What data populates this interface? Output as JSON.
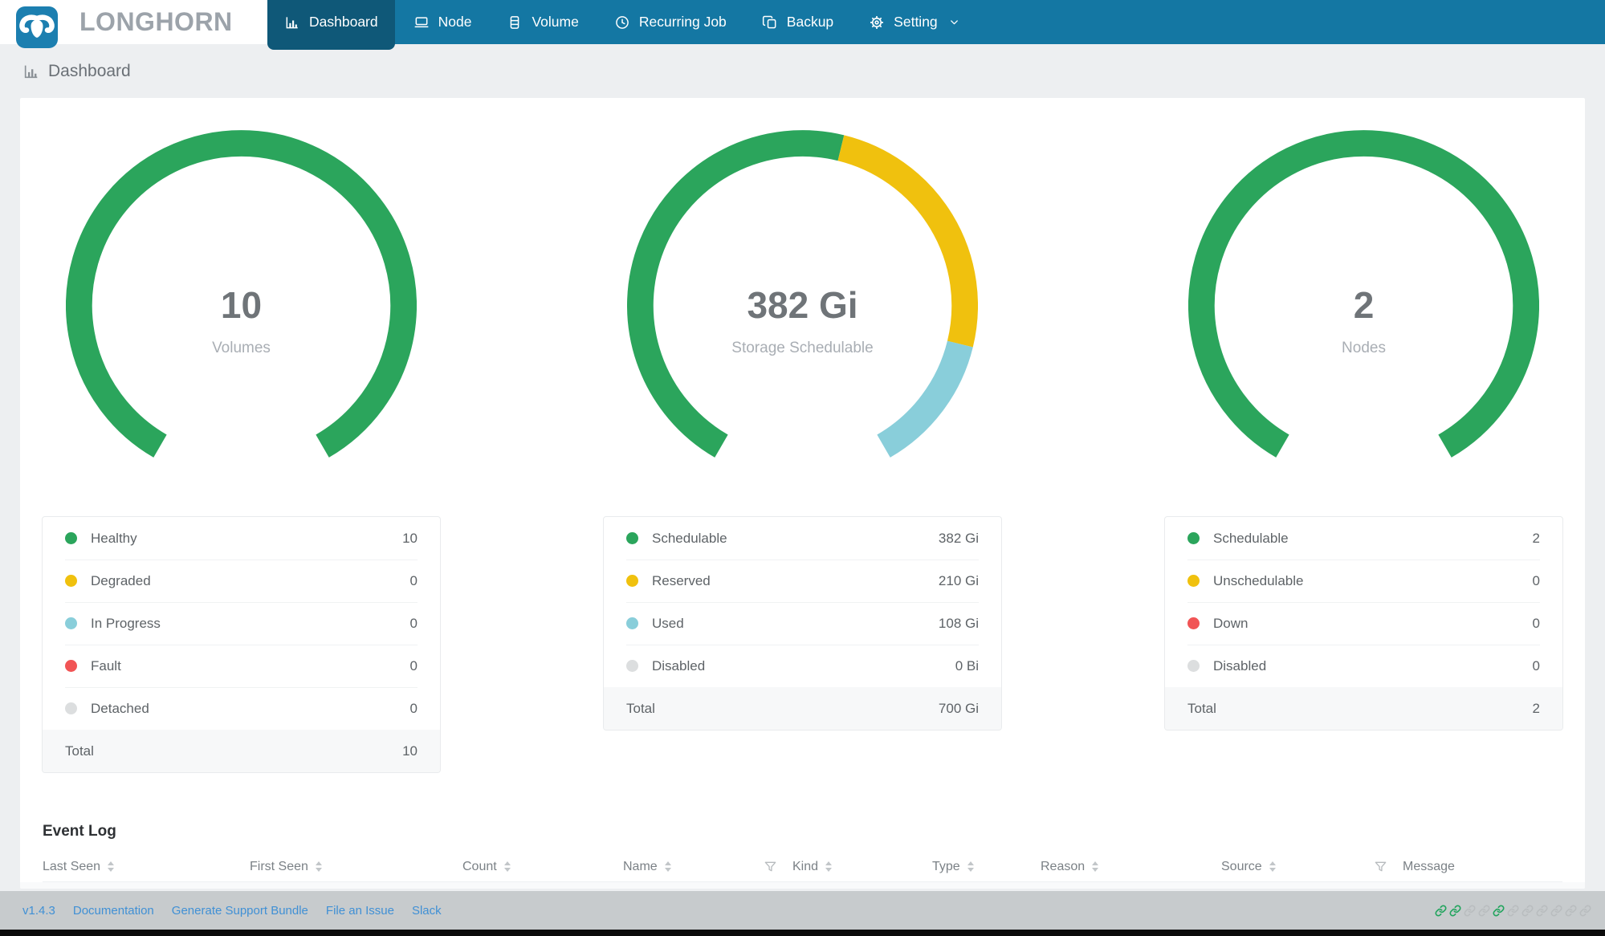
{
  "brand": {
    "name": "LONGHORN",
    "logo_icon": "bull-icon"
  },
  "nav": {
    "items": [
      {
        "label": "Dashboard",
        "icon": "bar-chart-icon",
        "active": true,
        "has_dropdown": false
      },
      {
        "label": "Node",
        "icon": "node-icon",
        "active": false,
        "has_dropdown": false
      },
      {
        "label": "Volume",
        "icon": "volume-icon",
        "active": false,
        "has_dropdown": false
      },
      {
        "label": "Recurring Job",
        "icon": "clock-icon",
        "active": false,
        "has_dropdown": false
      },
      {
        "label": "Backup",
        "icon": "backup-icon",
        "active": false,
        "has_dropdown": false
      },
      {
        "label": "Setting",
        "icon": "gear-icon",
        "active": false,
        "has_dropdown": true
      }
    ]
  },
  "page": {
    "title": "Dashboard",
    "title_icon": "bar-chart-icon"
  },
  "chart_data": [
    {
      "type": "gauge",
      "center_value": "10",
      "center_label": "Volumes",
      "total": 10,
      "arc_span_degrees": 300,
      "segments": [
        {
          "name": "Healthy",
          "value": 10,
          "color": "#2BA55C"
        }
      ],
      "legend": [
        {
          "label": "Healthy",
          "value": "10",
          "color": "#2BA55C"
        },
        {
          "label": "Degraded",
          "value": "0",
          "color": "#F0C10E"
        },
        {
          "label": "In Progress",
          "value": "0",
          "color": "#89CEDA"
        },
        {
          "label": "Fault",
          "value": "0",
          "color": "#F15455"
        },
        {
          "label": "Detached",
          "value": "0",
          "color": "#DCDEDF"
        }
      ],
      "total_row": {
        "label": "Total",
        "value": "10"
      }
    },
    {
      "type": "gauge",
      "center_value": "382 Gi",
      "center_label": "Storage Schedulable",
      "total": 700,
      "arc_span_degrees": 300,
      "segments": [
        {
          "name": "Schedulable",
          "value": 382,
          "color": "#2BA55C"
        },
        {
          "name": "Reserved",
          "value": 210,
          "color": "#F0C10E"
        },
        {
          "name": "Used",
          "value": 108,
          "color": "#89CEDA"
        }
      ],
      "legend": [
        {
          "label": "Schedulable",
          "value": "382 Gi",
          "color": "#2BA55C"
        },
        {
          "label": "Reserved",
          "value": "210 Gi",
          "color": "#F0C10E"
        },
        {
          "label": "Used",
          "value": "108 Gi",
          "color": "#89CEDA"
        },
        {
          "label": "Disabled",
          "value": "0 Bi",
          "color": "#DCDEDF"
        }
      ],
      "total_row": {
        "label": "Total",
        "value": "700 Gi"
      }
    },
    {
      "type": "gauge",
      "center_value": "2",
      "center_label": "Nodes",
      "total": 2,
      "arc_span_degrees": 300,
      "segments": [
        {
          "name": "Schedulable",
          "value": 2,
          "color": "#2BA55C"
        }
      ],
      "legend": [
        {
          "label": "Schedulable",
          "value": "2",
          "color": "#2BA55C"
        },
        {
          "label": "Unschedulable",
          "value": "0",
          "color": "#F0C10E"
        },
        {
          "label": "Down",
          "value": "0",
          "color": "#F15455"
        },
        {
          "label": "Disabled",
          "value": "0",
          "color": "#DCDEDF"
        }
      ],
      "total_row": {
        "label": "Total",
        "value": "2"
      }
    }
  ],
  "event_log": {
    "title": "Event Log",
    "columns": [
      {
        "label": "Last Seen",
        "sortable": true,
        "filterable": false
      },
      {
        "label": "First Seen",
        "sortable": true,
        "filterable": false
      },
      {
        "label": "Count",
        "sortable": true,
        "filterable": false
      },
      {
        "label": "Name",
        "sortable": true,
        "filterable": false
      },
      {
        "label": "Kind",
        "sortable": true,
        "filterable": true
      },
      {
        "label": "Type",
        "sortable": true,
        "filterable": false
      },
      {
        "label": "Reason",
        "sortable": true,
        "filterable": false
      },
      {
        "label": "Source",
        "sortable": true,
        "filterable": false
      },
      {
        "label": "Message",
        "sortable": false,
        "filterable": true
      }
    ],
    "rows": []
  },
  "footer": {
    "version": "v1.4.3",
    "links": [
      "Documentation",
      "Generate Support Bundle",
      "File an Issue",
      "Slack"
    ],
    "connection_status_colors": {
      "connected": "#21A45D",
      "disconnected": "#B9BDBF"
    },
    "connection_indicators": [
      "connected",
      "connected",
      "disconnected",
      "disconnected",
      "connected",
      "disconnected",
      "disconnected",
      "disconnected",
      "disconnected",
      "disconnected",
      "disconnected"
    ]
  },
  "theme": {
    "header_bg": "#1477A3",
    "active_tab_bg": "#0F5878",
    "logo_bg": "#1C7FB0",
    "page_bg": "#EDEFF1",
    "footer_bg": "#C7CBCD",
    "link_color": "#4090D5"
  }
}
